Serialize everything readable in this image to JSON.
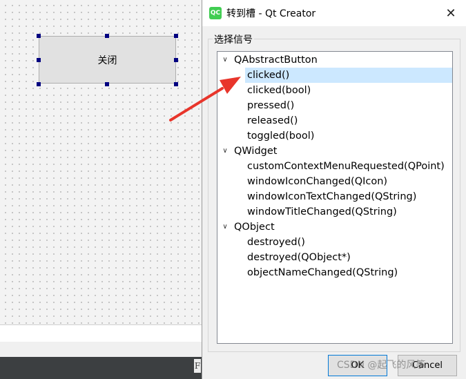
{
  "canvas": {
    "button_label": "关闭",
    "status_glyph": "F"
  },
  "dialog": {
    "title": "转到槽 - Qt Creator",
    "logo_text": "QC",
    "close_glyph": "✕",
    "group_label": "选择信号",
    "ok_label": "OK",
    "cancel_label": "Cancel"
  },
  "tree": {
    "groups": [
      {
        "name": "QAbstractButton",
        "signals": [
          "clicked()",
          "clicked(bool)",
          "pressed()",
          "released()",
          "toggled(bool)"
        ]
      },
      {
        "name": "QWidget",
        "signals": [
          "customContextMenuRequested(QPoint)",
          "windowIconChanged(QIcon)",
          "windowIconTextChanged(QString)",
          "windowTitleChanged(QString)"
        ]
      },
      {
        "name": "QObject",
        "signals": [
          "destroyed()",
          "destroyed(QObject*)",
          "objectNameChanged(QString)"
        ]
      }
    ],
    "selected": "clicked()",
    "expand_glyph": "∨"
  },
  "watermark": "CSDN @起飞的风筝",
  "colors": {
    "selection": "#cce8ff",
    "arrow": "#e8352b",
    "handle": "#000080",
    "statusbar": "#3c3f41"
  }
}
